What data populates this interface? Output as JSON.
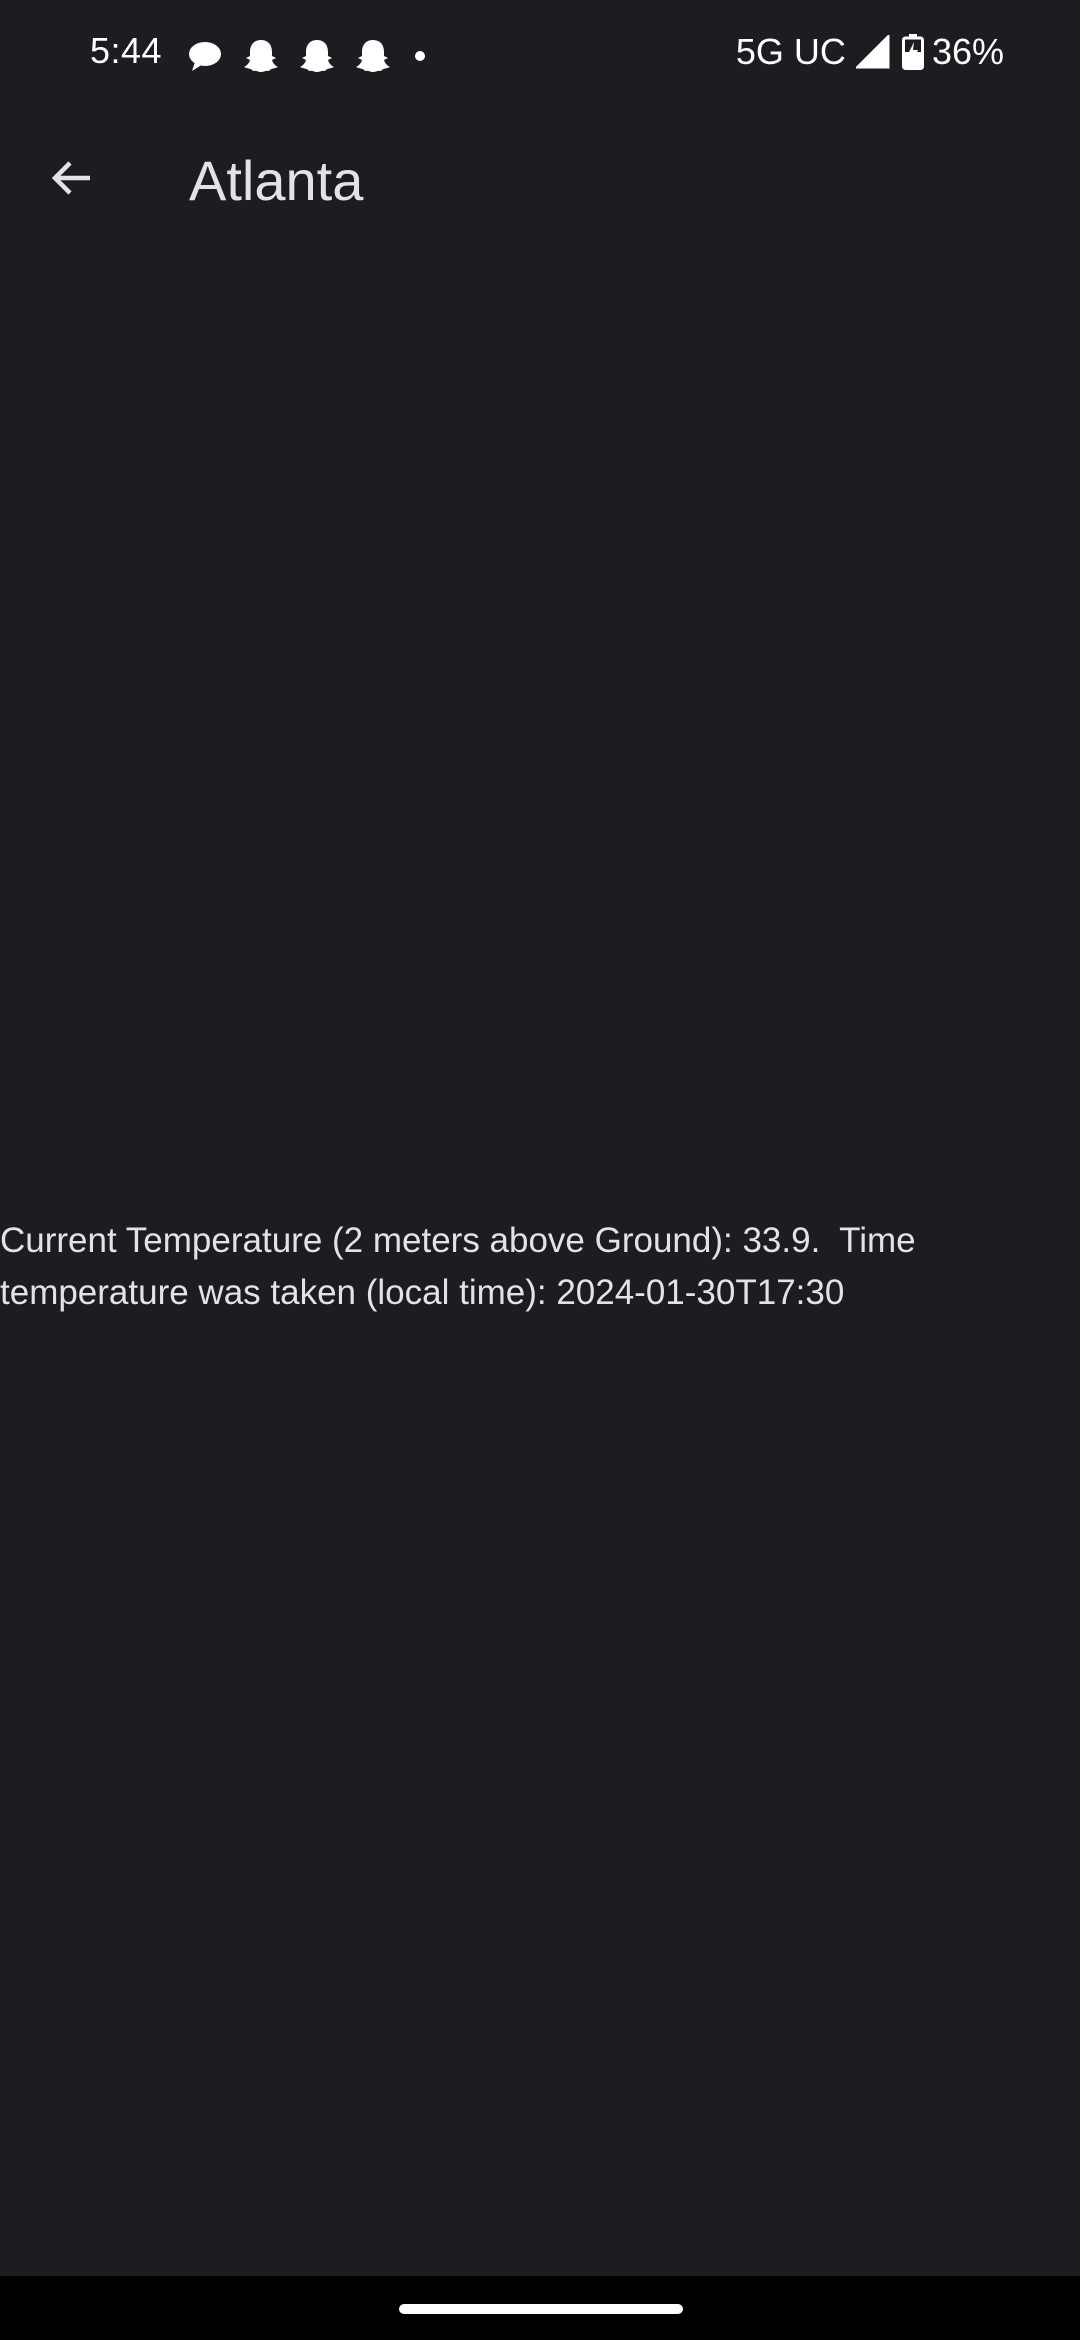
{
  "status_bar": {
    "time": "5:44",
    "notification_icons": [
      "chat-bubble-icon",
      "snapchat-ghost-icon",
      "snapchat-ghost-icon",
      "snapchat-ghost-icon",
      "dot-icon"
    ],
    "network": "5G UC",
    "battery_percent": "36%"
  },
  "app_bar": {
    "back_icon": "arrow-left-icon",
    "title": "Atlanta"
  },
  "content": {
    "temperature_text": "Current Temperature (2 meters above Ground): 33.9.  Time temperature was taken (local time): 2024-01-30T17:30"
  },
  "colors": {
    "background": "#1d1c21",
    "text": "#e4e2e8",
    "nav_bar": "#000000"
  }
}
